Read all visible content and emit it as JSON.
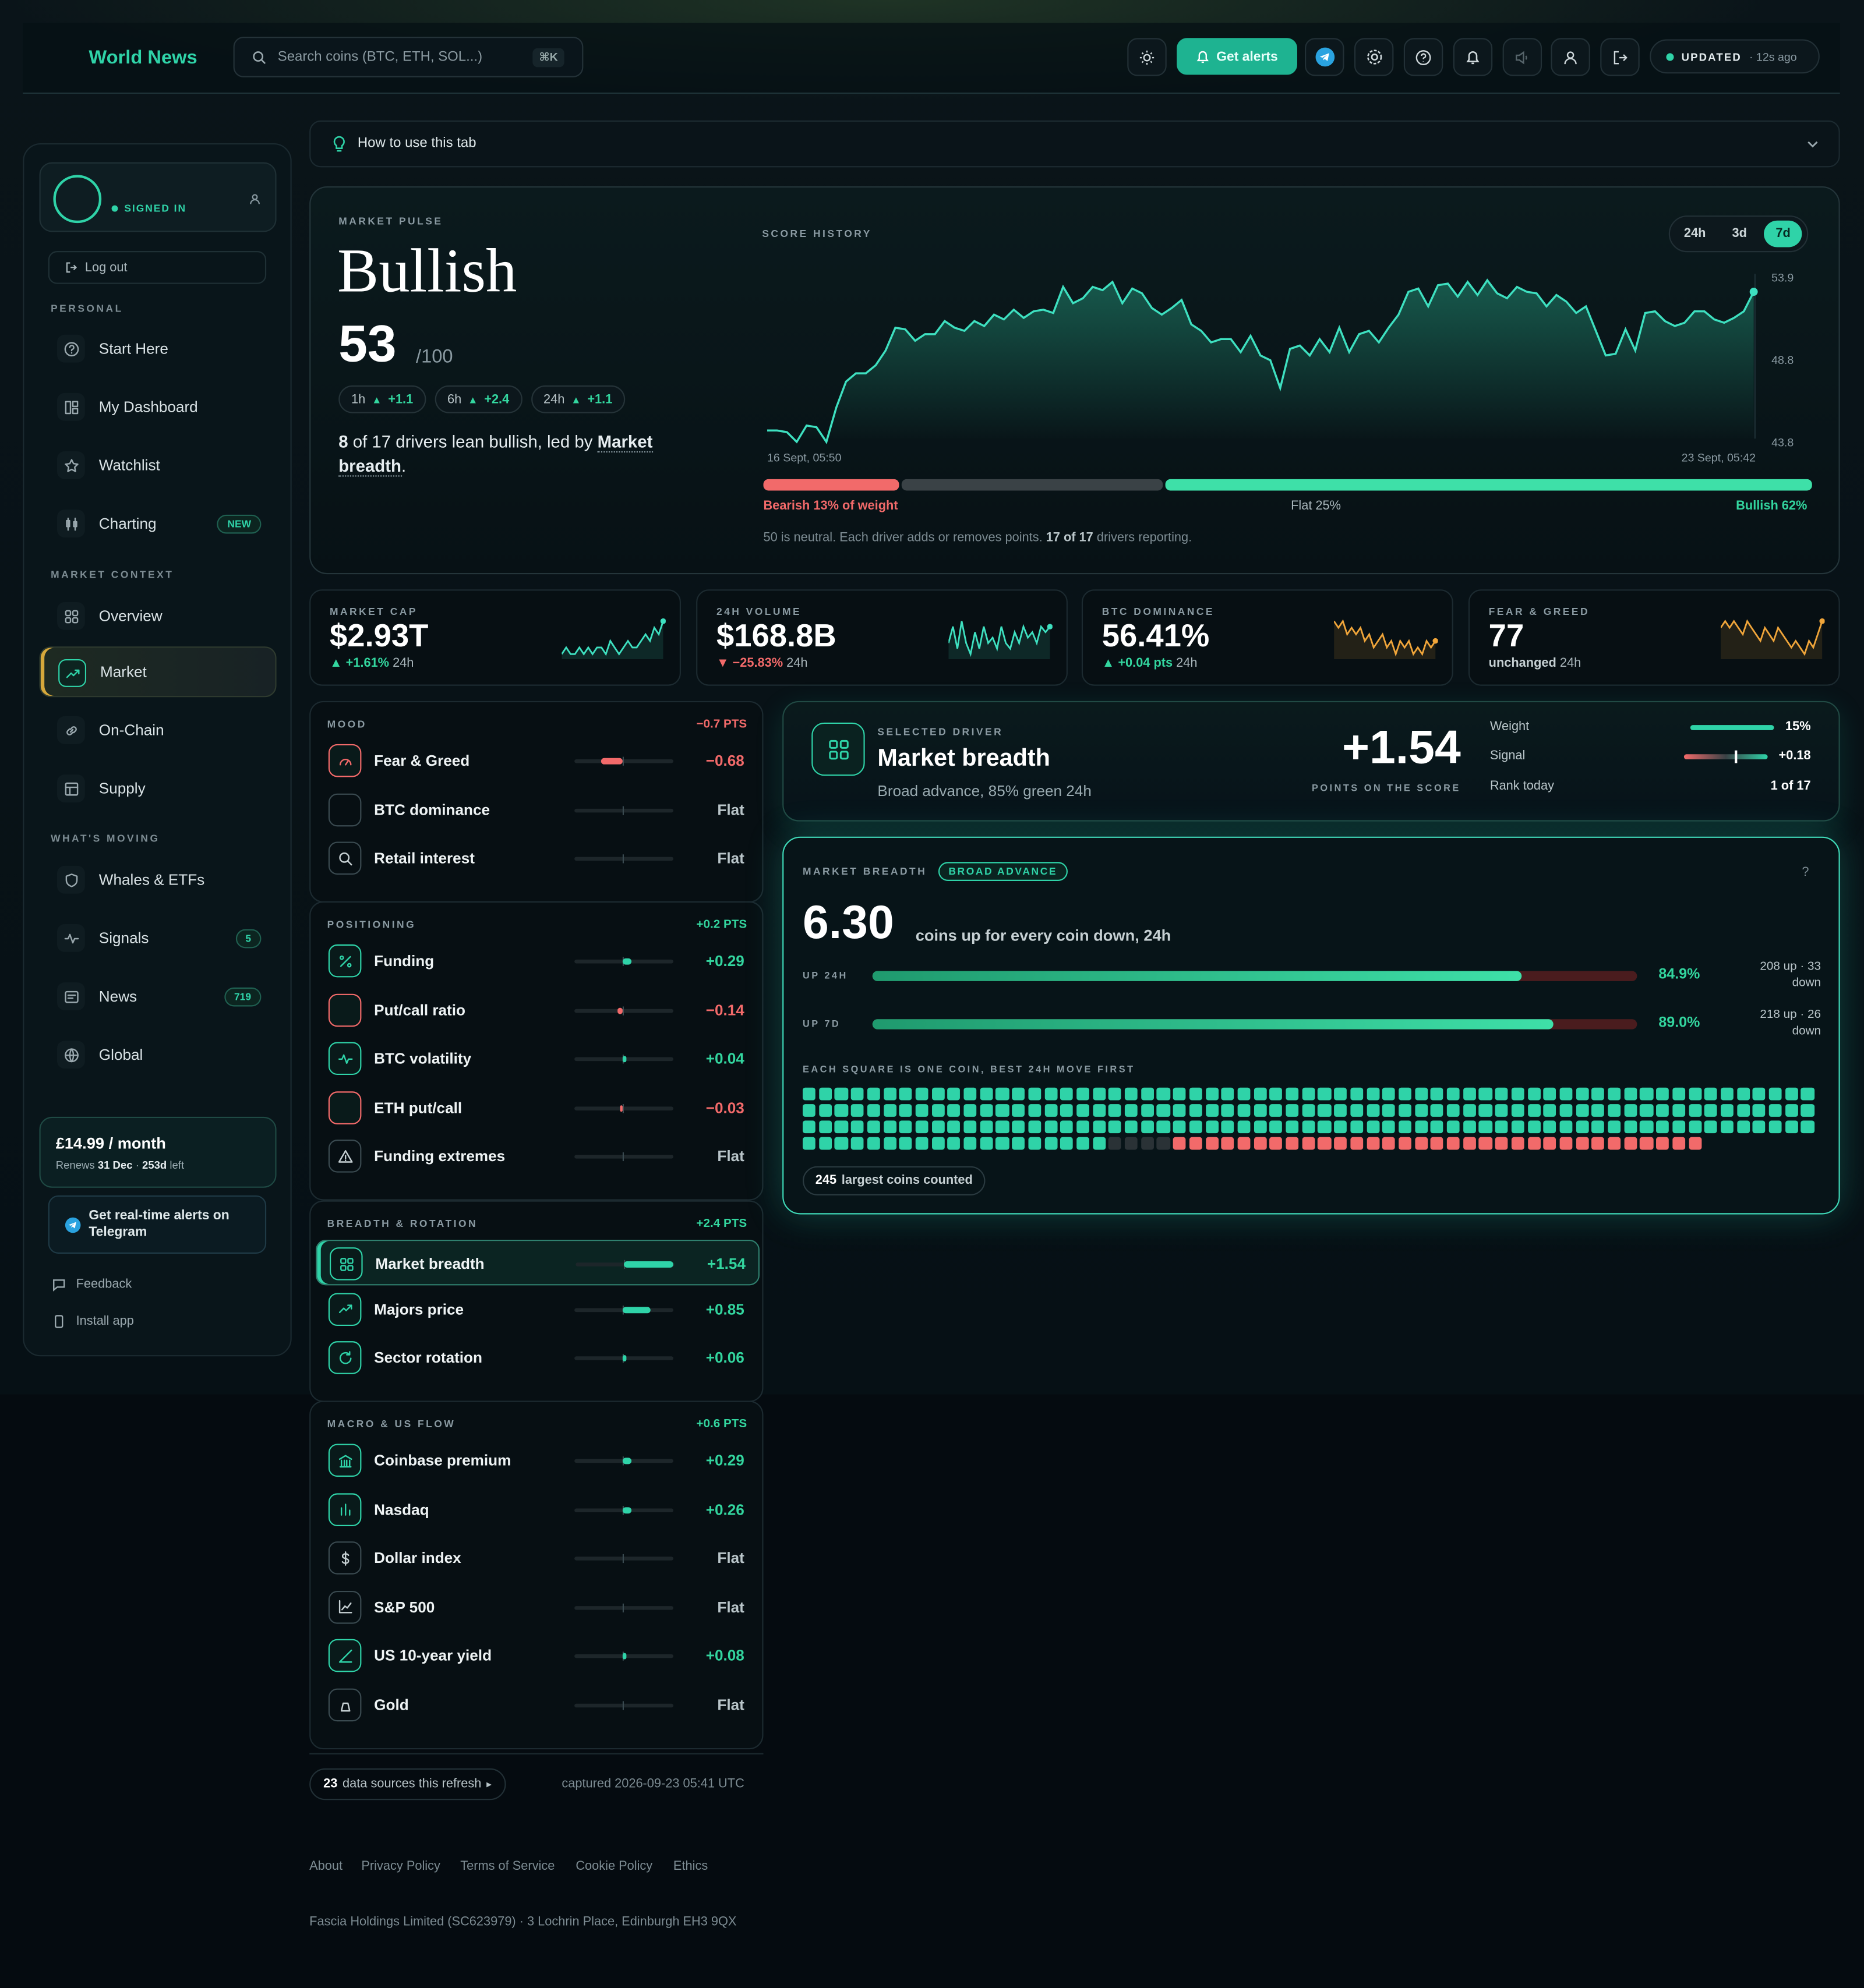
{
  "header": {
    "brand": "World News",
    "search_placeholder": "Search coins (BTC, ETH, SOL...)",
    "search_kbd": "⌘K",
    "alerts_label": "Get alerts",
    "updated_label": "UPDATED",
    "updated_age": "· 12s ago"
  },
  "sidebar": {
    "signed_in": "SIGNED IN",
    "logout": "Log out",
    "sections": [
      "PERSONAL",
      "MARKET CONTEXT",
      "WHAT'S MOVING"
    ],
    "items": [
      {
        "label": "Start Here",
        "icon": "help-circle-icon"
      },
      {
        "label": "My Dashboard",
        "icon": "dashboard-icon"
      },
      {
        "label": "Watchlist",
        "icon": "star-icon"
      },
      {
        "label": "Charting",
        "icon": "candles-icon",
        "badge": "NEW"
      },
      {
        "label": "Overview",
        "icon": "grid-icon"
      },
      {
        "label": "Market",
        "icon": "trend-up-icon",
        "active": true
      },
      {
        "label": "On-Chain",
        "icon": "link-icon"
      },
      {
        "label": "Supply",
        "icon": "supply-icon"
      },
      {
        "label": "Whales & ETFs",
        "icon": "shield-icon"
      },
      {
        "label": "Signals",
        "icon": "pulse-icon",
        "badge": "5"
      },
      {
        "label": "News",
        "icon": "news-icon",
        "badge": "719"
      },
      {
        "label": "Global",
        "icon": "globe-icon"
      }
    ],
    "subscription": {
      "price": "£14.99 / month",
      "renews_pre": "Renews",
      "renews_date": "31 Dec",
      "renews_mid": "·",
      "renews_left": "253d",
      "renews_post": "left"
    },
    "telegram": "Get real-time alerts on Telegram",
    "feedback": "Feedback",
    "install": "Install app"
  },
  "howto": "How to use this tab",
  "pulse": {
    "cap": "MARKET PULSE",
    "state": "Bullish",
    "score": "53",
    "max": "/100",
    "chips": [
      {
        "p": "1h",
        "v": "+1.1"
      },
      {
        "p": "6h",
        "v": "+2.4"
      },
      {
        "p": "24h",
        "v": "+1.1"
      }
    ],
    "summary_n": "8",
    "summary_mid": " of 17 drivers lean bullish, led by",
    "summary_lead": "Market breadth",
    "summary_end": ".",
    "history_cap": "SCORE HISTORY",
    "ranges": [
      "24h",
      "3d",
      "7d"
    ],
    "selected_range": "7d",
    "ymax": "53.9",
    "ymid": "48.8",
    "ymin": "43.8",
    "x_start": "16 Sept, 05:50",
    "x_end": "23 Sept, 05:42",
    "weights": {
      "bearish": 13,
      "flat": 25,
      "bullish": 62
    },
    "bearish_label": "Bearish 13% of weight",
    "flat_label": "Flat 25%",
    "bullish_label": "Bullish 62%",
    "note_pre": "50 is neutral. Each driver adds or removes points.",
    "note_count": "17 of 17",
    "note_post": "drivers reporting.",
    "colors": {
      "bearish": "#f26a6a",
      "flat": "#3a4246",
      "bullish": "#3ee0a8"
    }
  },
  "chart_data": {
    "type": "line",
    "title": "",
    "ylim": [
      43.8,
      53.9
    ],
    "x_start": "16 Sept, 05:50",
    "x_end": "23 Sept, 05:42",
    "values": [
      44.3,
      44.3,
      44.2,
      43.6,
      44.6,
      44.5,
      43.6,
      45.7,
      47.3,
      47.8,
      47.8,
      48.3,
      49.2,
      50.6,
      50.5,
      49.8,
      50.2,
      50.2,
      51.0,
      50.6,
      50.4,
      51.0,
      50.7,
      51.4,
      51.1,
      51.7,
      51.2,
      51.6,
      51.7,
      51.5,
      53.1,
      52.1,
      52.4,
      53.1,
      52.9,
      53.4,
      52.1,
      53.0,
      52.7,
      51.8,
      51.4,
      51.8,
      52.3,
      50.8,
      50.4,
      49.7,
      49.9,
      49.9,
      49.1,
      50.1,
      48.9,
      48.6,
      46.9,
      49.3,
      49.5,
      48.9,
      49.9,
      49.1,
      50.6,
      49.1,
      50.2,
      50.4,
      49.7,
      50.6,
      51.4,
      52.8,
      53.0,
      51.9,
      53.2,
      53.3,
      52.5,
      53.4,
      52.6,
      53.5,
      52.7,
      52.4,
      53.1,
      52.8,
      52.7,
      51.9,
      52.6,
      52.2,
      51.5,
      51.9,
      50.4,
      48.9,
      49.0,
      50.5,
      49.2,
      51.5,
      51.6,
      51.0,
      50.7,
      50.9,
      51.6,
      51.6,
      51.1,
      50.9,
      51.2,
      51.6,
      52.8
    ]
  },
  "stats": [
    {
      "title": "MARKET CAP",
      "value": "$2.93T",
      "change": "▲ +1.61%",
      "period": "24h",
      "dir": "up",
      "spark": [
        5,
        6,
        5,
        5,
        6,
        5,
        6,
        5,
        6,
        6,
        5,
        7,
        6,
        5,
        6,
        7,
        6,
        6,
        7,
        8,
        7,
        9,
        8,
        10
      ]
    },
    {
      "title": "24H VOLUME",
      "value": "$168.8B",
      "change": "▼ −25.83%",
      "period": "24h",
      "dir": "down",
      "spark": [
        6,
        9,
        5,
        10,
        6,
        4,
        8,
        5,
        9,
        6,
        7,
        5,
        9,
        6,
        5,
        8,
        6,
        9,
        7,
        8,
        6,
        9,
        8,
        9
      ]
    },
    {
      "title": "BTC DOMINANCE",
      "value": "56.41%",
      "change": "▲ +0.04 pts",
      "period": "24h",
      "dir": "up",
      "spark": [
        9,
        8,
        9,
        7,
        8,
        7,
        8,
        6,
        7,
        5,
        6,
        7,
        5,
        6,
        4,
        6,
        5,
        6,
        4,
        5,
        4,
        6,
        5,
        6
      ]
    },
    {
      "title": "FEAR & GREED",
      "value": "77",
      "change": "unchanged",
      "period": "24h",
      "dir": "flat",
      "spark": [
        8,
        9,
        8,
        9,
        8,
        7,
        9,
        8,
        7,
        6,
        8,
        7,
        6,
        8,
        7,
        6,
        5,
        6,
        5,
        4,
        6,
        5,
        7,
        9
      ]
    }
  ],
  "groups": [
    {
      "title": "MOOD",
      "pts": "−0.7 PTS",
      "dir": "down",
      "rows": [
        {
          "name": "Fear & Greed",
          "value": "−0.68",
          "bar": -0.68,
          "icon": "gauge-icon",
          "dir": "down"
        },
        {
          "name": "BTC dominance",
          "value": "Flat",
          "bar": 0,
          "icon": "bitcoin-icon",
          "dir": "flat"
        },
        {
          "name": "Retail interest",
          "value": "Flat",
          "bar": 0,
          "icon": "search-icon",
          "dir": "flat"
        }
      ]
    },
    {
      "title": "POSITIONING",
      "pts": "+0.2 PTS",
      "dir": "up",
      "rows": [
        {
          "name": "Funding",
          "value": "+0.29",
          "bar": 0.29,
          "icon": "percent-icon",
          "dir": "up"
        },
        {
          "name": "Put/call ratio",
          "value": "−0.14",
          "bar": -0.14,
          "icon": "scale-icon",
          "dir": "down"
        },
        {
          "name": "BTC volatility",
          "value": "+0.04",
          "bar": 0.04,
          "icon": "pulse-icon",
          "dir": "up"
        },
        {
          "name": "ETH put/call",
          "value": "−0.03",
          "bar": -0.03,
          "icon": "eth-icon",
          "dir": "down"
        },
        {
          "name": "Funding extremes",
          "value": "Flat",
          "bar": 0,
          "icon": "warning-icon",
          "dir": "flat"
        }
      ]
    },
    {
      "title": "BREADTH & ROTATION",
      "pts": "+2.4 PTS",
      "dir": "up",
      "rows": [
        {
          "name": "Market breadth",
          "value": "+1.54",
          "bar": 1.54,
          "icon": "grid-icon",
          "dir": "up",
          "selected": true
        },
        {
          "name": "Majors price",
          "value": "+0.85",
          "bar": 0.85,
          "icon": "trend-up-icon",
          "dir": "up"
        },
        {
          "name": "Sector rotation",
          "value": "+0.06",
          "bar": 0.06,
          "icon": "rotate-icon",
          "dir": "up"
        }
      ]
    },
    {
      "title": "MACRO & US FLOW",
      "pts": "+0.6 PTS",
      "dir": "up",
      "rows": [
        {
          "name": "Coinbase premium",
          "value": "+0.29",
          "bar": 0.29,
          "icon": "bank-icon",
          "dir": "up"
        },
        {
          "name": "Nasdaq",
          "value": "+0.26",
          "bar": 0.26,
          "icon": "bar-chart-icon",
          "dir": "up"
        },
        {
          "name": "Dollar index",
          "value": "Flat",
          "bar": 0,
          "icon": "dollar-icon",
          "dir": "flat"
        },
        {
          "name": "S&P 500",
          "value": "Flat",
          "bar": 0,
          "icon": "line-chart-icon",
          "dir": "flat"
        },
        {
          "name": "US 10-year yield",
          "value": "+0.08",
          "bar": 0.08,
          "icon": "yield-icon",
          "dir": "up"
        },
        {
          "name": "Gold",
          "value": "Flat",
          "bar": 0,
          "icon": "gold-icon",
          "dir": "flat"
        }
      ]
    }
  ],
  "sources": {
    "count": "23",
    "label": "data sources this refresh",
    "arrow": "▸",
    "captured": "captured 2026-09-23 05:41 UTC"
  },
  "selected_driver": {
    "cap": "SELECTED DRIVER",
    "name": "Market breadth",
    "desc": "Broad advance, 85% green 24h",
    "points": "+1.54",
    "points_cap": "POINTS ON THE SCORE",
    "weight_label": "Weight",
    "weight_value": "15%",
    "weight": 0.15,
    "signal_label": "Signal",
    "signal_value": "+0.18",
    "signal": 0.18,
    "rank_label": "Rank today",
    "rank_value": "1 of 17"
  },
  "breadth": {
    "cap": "MARKET BREADTH",
    "badge": "BROAD ADVANCE",
    "help": "?",
    "ratio": "6.30",
    "ratio_desc": "coins up for every coin down, 24h",
    "rows": [
      {
        "label": "UP 24H",
        "pct": "84.9%",
        "fill": 84.9,
        "counts": "208 up · 33 down"
      },
      {
        "label": "UP 7D",
        "pct": "89.0%",
        "fill": 89.0,
        "counts": "218 up · 26 down"
      }
    ],
    "grid_cap": "EACH SQUARE IS ONE COIN, BEST 24H MOVE FIRST",
    "up": 208,
    "flat": 4,
    "down": 33,
    "total_label": "245",
    "total_text": "largest coins counted"
  },
  "footer": {
    "links": [
      "About",
      "Privacy Policy",
      "Terms of Service",
      "Cookie Policy",
      "Ethics"
    ],
    "company": "Fascia Holdings Limited (SC623979) · 3 Lochrin Place, Edinburgh EH3 9QX"
  }
}
